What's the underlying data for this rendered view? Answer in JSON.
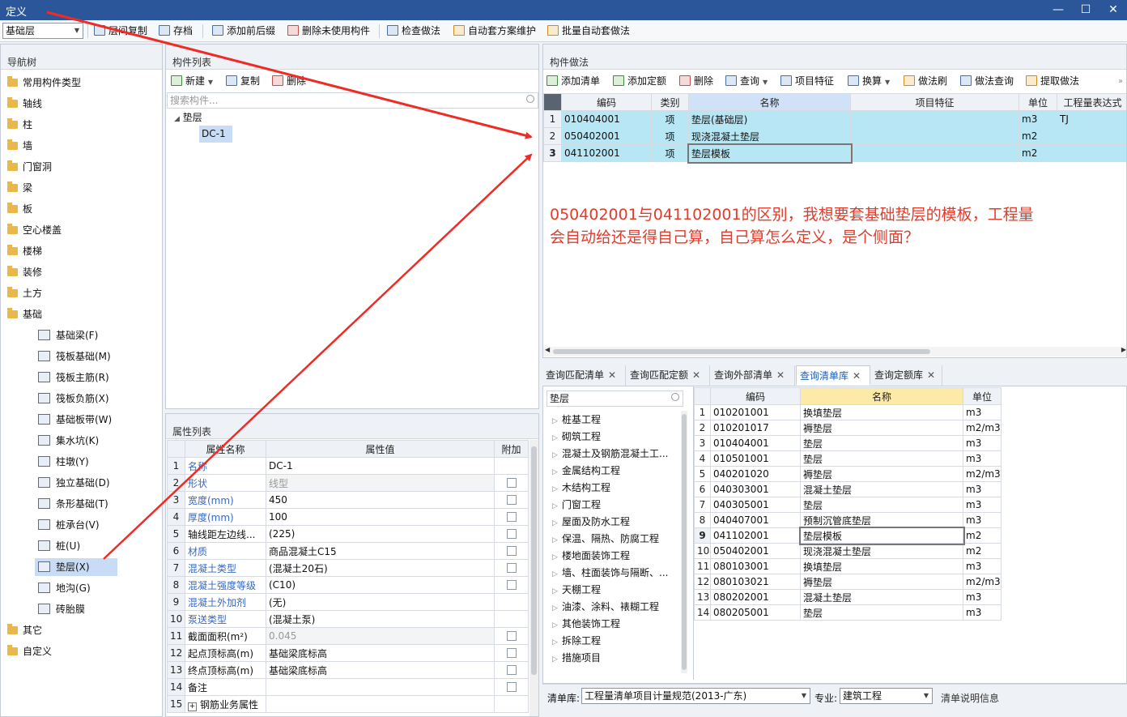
{
  "window": {
    "title": "定义",
    "min": "—",
    "max": "☐",
    "close": "✕"
  },
  "toolbar": {
    "floor": "基础层",
    "buttons": [
      "层间复制",
      "存档",
      "添加前后缀",
      "删除未使用构件",
      "检查做法",
      "自动套方案维护",
      "批量自动套做法"
    ]
  },
  "nav": {
    "title": "导航树",
    "top_items": [
      "常用构件类型",
      "轴线",
      "柱",
      "墙",
      "门窗洞",
      "梁",
      "板",
      "空心楼盖",
      "楼梯",
      "装修",
      "土方",
      "基础"
    ],
    "sub_items": [
      "基础梁(F)",
      "筏板基础(M)",
      "筏板主筋(R)",
      "筏板负筋(X)",
      "基础板带(W)",
      "集水坑(K)",
      "柱墩(Y)",
      "独立基础(D)",
      "条形基础(T)",
      "桩承台(V)",
      "桩(U)",
      "垫层(X)",
      "地沟(G)",
      "砖胎膜"
    ],
    "bottom_items": [
      "其它",
      "自定义"
    ]
  },
  "component_list": {
    "title": "构件列表",
    "buttons": [
      "新建",
      "复制",
      "删除"
    ],
    "search_placeholder": "搜索构件...",
    "tree_group": "垫层",
    "tree_item": "DC-1"
  },
  "attributes": {
    "title": "属性列表",
    "headers": [
      "属性名称",
      "属性值",
      "附加"
    ],
    "rows": [
      {
        "n": "1",
        "name": "名称",
        "value": "DC-1",
        "link": true,
        "cb": false,
        "dis": false
      },
      {
        "n": "2",
        "name": "形状",
        "value": "线型",
        "link": true,
        "cb": true,
        "dis": true
      },
      {
        "n": "3",
        "name": "宽度(mm)",
        "value": "450",
        "link": true,
        "cb": true,
        "dis": false
      },
      {
        "n": "4",
        "name": "厚度(mm)",
        "value": "100",
        "link": true,
        "cb": true,
        "dis": false
      },
      {
        "n": "5",
        "name": "轴线距左边线...",
        "value": "(225)",
        "link": false,
        "cb": true,
        "dis": false
      },
      {
        "n": "6",
        "name": "材质",
        "value": "商品混凝土C15",
        "link": true,
        "cb": true,
        "dis": false
      },
      {
        "n": "7",
        "name": "混凝土类型",
        "value": "(混凝土20石)",
        "link": true,
        "cb": true,
        "dis": false
      },
      {
        "n": "8",
        "name": "混凝土强度等级",
        "value": "(C10)",
        "link": true,
        "cb": true,
        "dis": false
      },
      {
        "n": "9",
        "name": "混凝土外加剂",
        "value": "(无)",
        "link": true,
        "cb": false,
        "dis": false
      },
      {
        "n": "10",
        "name": "泵送类型",
        "value": "(混凝土泵)",
        "link": true,
        "cb": false,
        "dis": false
      },
      {
        "n": "11",
        "name": "截面面积(m²)",
        "value": "0.045",
        "link": false,
        "cb": true,
        "dis": true
      },
      {
        "n": "12",
        "name": "起点顶标高(m)",
        "value": "基础梁底标高",
        "link": false,
        "cb": true,
        "dis": false
      },
      {
        "n": "13",
        "name": "终点顶标高(m)",
        "value": "基础梁底标高",
        "link": false,
        "cb": true,
        "dis": false
      },
      {
        "n": "14",
        "name": "备注",
        "value": "",
        "link": false,
        "cb": true,
        "dis": false
      },
      {
        "n": "15",
        "name": "钢筋业务属性",
        "value": "",
        "link": false,
        "cb": false,
        "dis": false
      }
    ]
  },
  "method": {
    "title": "构件做法",
    "buttons": [
      "添加清单",
      "添加定额",
      "删除",
      "查询",
      "项目特征",
      "换算",
      "做法刷",
      "做法查询",
      "提取做法"
    ],
    "headers": [
      "编码",
      "类别",
      "名称",
      "项目特征",
      "单位",
      "工程量表达式"
    ],
    "rows": [
      {
        "n": "1",
        "code": "010404001",
        "type": "项",
        "name": "垫层(基础层)",
        "feature": "",
        "unit": "m3",
        "expr": "TJ"
      },
      {
        "n": "2",
        "code": "050402001",
        "type": "项",
        "name": "现浇混凝土垫层",
        "feature": "",
        "unit": "m2",
        "expr": ""
      },
      {
        "n": "3",
        "code": "041102001",
        "type": "项",
        "name": "垫层模板",
        "feature": "",
        "unit": "m2",
        "expr": ""
      }
    ]
  },
  "annotation": {
    "line1": "050402001与041102001的区别，我想要套基础垫层的模板，工程量",
    "line2": "会自动给还是得自己算，自己算怎么定义，是个侧面？"
  },
  "tabs": [
    "查询匹配清单",
    "查询匹配定额",
    "查询外部清单",
    "查询清单库",
    "查询定额库"
  ],
  "library": {
    "search_value": "垫层",
    "tree": [
      "桩基工程",
      "砌筑工程",
      "混凝土及钢筋混凝土工...",
      "金属结构工程",
      "木结构工程",
      "门窗工程",
      "屋面及防水工程",
      "保温、隔热、防腐工程",
      "楼地面装饰工程",
      "墙、柱面装饰与隔断、...",
      "天棚工程",
      "油漆、涂料、裱糊工程",
      "其他装饰工程",
      "拆除工程",
      "措施项目"
    ],
    "headers": [
      "编码",
      "名称",
      "单位"
    ],
    "rows": [
      {
        "n": "1",
        "code": "010201001",
        "name": "换填垫层",
        "unit": "m3"
      },
      {
        "n": "2",
        "code": "010201017",
        "name": "褥垫层",
        "unit": "m2/m3"
      },
      {
        "n": "3",
        "code": "010404001",
        "name": "垫层",
        "unit": "m3"
      },
      {
        "n": "4",
        "code": "010501001",
        "name": "垫层",
        "unit": "m3"
      },
      {
        "n": "5",
        "code": "040201020",
        "name": "褥垫层",
        "unit": "m2/m3"
      },
      {
        "n": "6",
        "code": "040303001",
        "name": "混凝土垫层",
        "unit": "m3"
      },
      {
        "n": "7",
        "code": "040305001",
        "name": "垫层",
        "unit": "m3"
      },
      {
        "n": "8",
        "code": "040407001",
        "name": "预制沉管底垫层",
        "unit": "m3"
      },
      {
        "n": "9",
        "code": "041102001",
        "name": "垫层模板",
        "unit": "m2"
      },
      {
        "n": "10",
        "code": "050402001",
        "name": "现浇混凝土垫层",
        "unit": "m2"
      },
      {
        "n": "11",
        "code": "080103001",
        "name": "换填垫层",
        "unit": "m3"
      },
      {
        "n": "12",
        "code": "080103021",
        "name": "褥垫层",
        "unit": "m2/m3"
      },
      {
        "n": "13",
        "code": "080202001",
        "name": "混凝土垫层",
        "unit": "m3"
      },
      {
        "n": "14",
        "code": "080205001",
        "name": "垫层",
        "unit": "m3"
      }
    ],
    "footer": {
      "lib_label": "清单库:",
      "lib_value": "工程量清单项目计量规范(2013-广东)",
      "major_label": "专业:",
      "major_value": "建筑工程",
      "info": "清单说明信息"
    }
  },
  "colors": {
    "title_bar": "#2b579a",
    "row_highlight": "#b7e6f4",
    "arrow": "#ee2b24",
    "annotation": "#e23b2a"
  }
}
